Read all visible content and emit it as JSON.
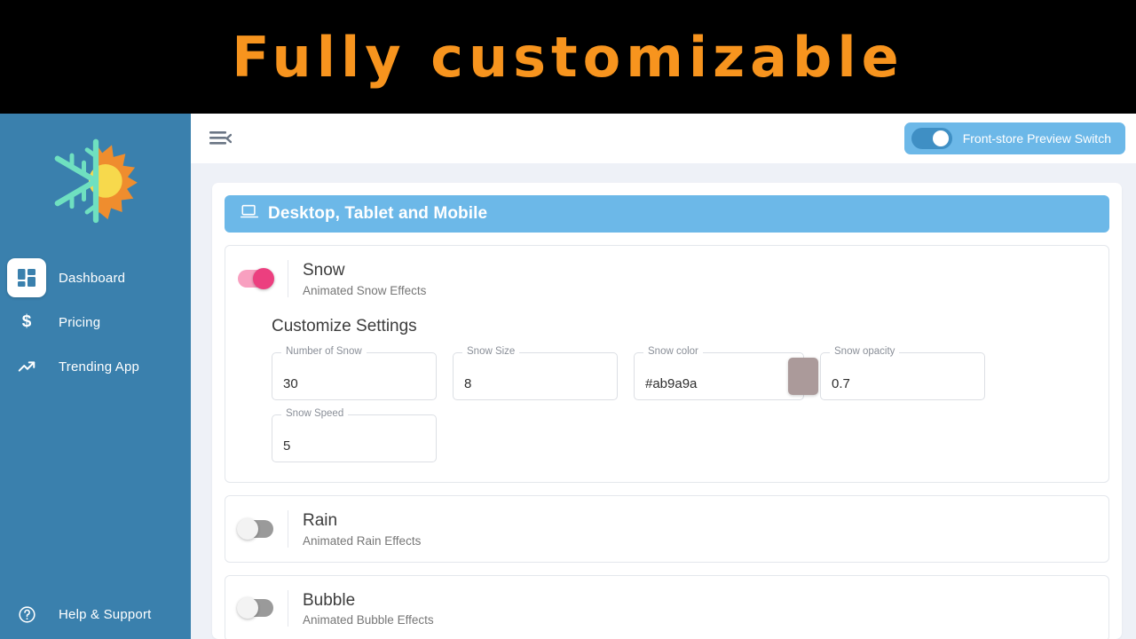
{
  "promo": {
    "text": "Fully customizable",
    "text_color": "#f7941e",
    "background": "#000000"
  },
  "sidebar": {
    "background": "#3a80ad",
    "logo_name": "snowflake-sun-logo",
    "items": [
      {
        "label": "Dashboard",
        "icon": "dashboard-grid-icon",
        "active": true
      },
      {
        "label": "Pricing",
        "icon": "dollar-icon",
        "active": false
      },
      {
        "label": "Trending App",
        "icon": "trending-up-icon",
        "active": false
      }
    ],
    "footer": {
      "label": "Help & Support",
      "icon": "help-circle-icon"
    }
  },
  "topbar": {
    "menu_icon": "menu-collapse-icon",
    "preview_switch": {
      "label": "Front-store Preview Switch",
      "enabled": true,
      "pill_color": "#6cb8e8",
      "track_color": "#3f8fc4"
    }
  },
  "panel": {
    "header": {
      "title": "Desktop, Tablet and Mobile",
      "icon": "desktop-monitor-icon",
      "background": "#6cb8e8"
    },
    "effects": [
      {
        "name": "Snow",
        "description": "Animated Snow Effects",
        "enabled": true,
        "toggle_on_color": "#ec3f7f",
        "settings_title": "Customize Settings",
        "settings": [
          {
            "label": "Number of Snow",
            "value": "30",
            "type": "number"
          },
          {
            "label": "Snow Size",
            "value": "8",
            "type": "number"
          },
          {
            "label": "Snow color",
            "value": "#ab9a9a",
            "type": "color",
            "swatch": "#ab9a9a"
          },
          {
            "label": "Snow opacity",
            "value": "0.7",
            "type": "number"
          },
          {
            "label": "Snow Speed",
            "value": "5",
            "type": "number"
          }
        ]
      },
      {
        "name": "Rain",
        "description": "Animated Rain Effects",
        "enabled": false,
        "settings": []
      },
      {
        "name": "Bubble",
        "description": "Animated Bubble Effects",
        "enabled": false,
        "settings": []
      }
    ]
  }
}
